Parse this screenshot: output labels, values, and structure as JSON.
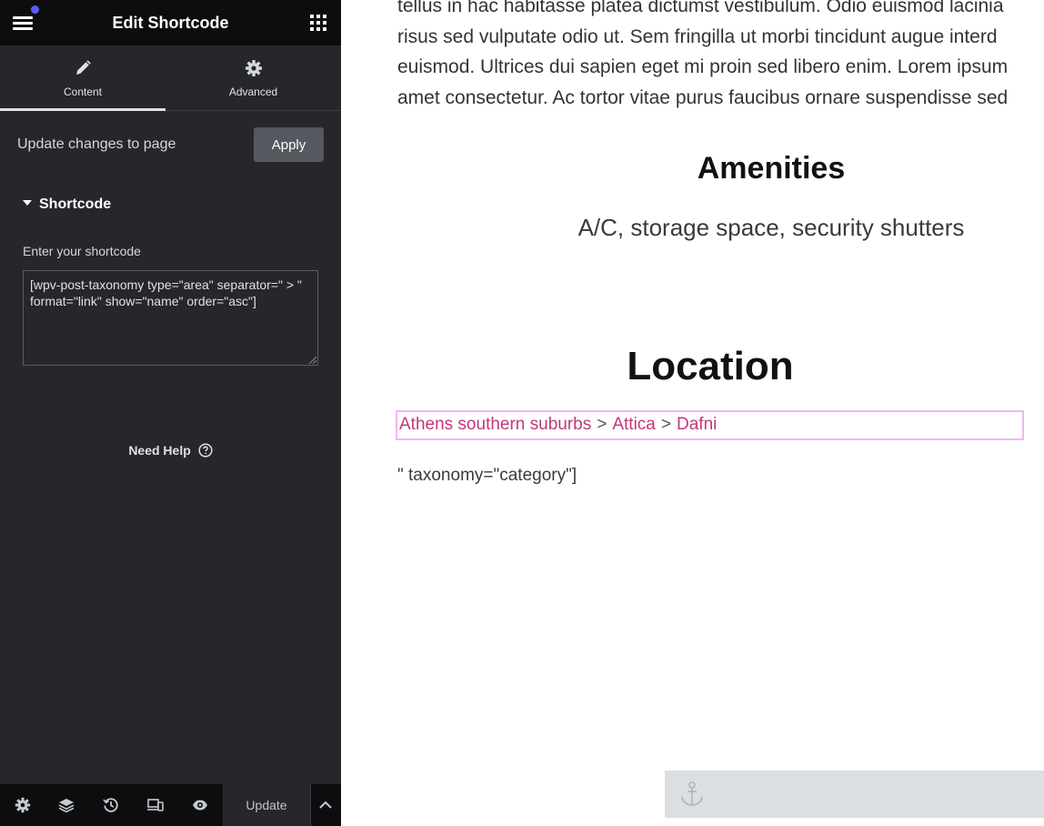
{
  "header": {
    "title": "Edit Shortcode"
  },
  "tabs": [
    {
      "label": "Content",
      "icon": "pencil-icon",
      "active": true
    },
    {
      "label": "Advanced",
      "icon": "gear-icon",
      "active": false
    }
  ],
  "apply_row": {
    "label": "Update changes to page",
    "button": "Apply"
  },
  "section": {
    "title": "Shortcode",
    "field_label": "Enter your shortcode",
    "field_value": "[wpv-post-taxonomy type=\"area\" separator=\" > \" format=\"link\" show=\"name\" order=\"asc\"]\n"
  },
  "help": {
    "label": "Need Help"
  },
  "footer": {
    "icons": [
      "settings-icon",
      "layers-icon",
      "history-icon",
      "responsive-icon",
      "eye-icon"
    ],
    "update_label": "Update"
  },
  "preview": {
    "paragraph_lines": [
      "tellus in hac habitasse platea dictumst vestibulum. Odio euismod lacinia",
      "risus sed vulputate odio ut. Sem fringilla ut morbi tincidunt augue interd",
      "euismod. Ultrices dui sapien eget mi proin sed libero enim. Lorem ipsum",
      "amet consectetur. Ac tortor vitae purus faucibus ornare suspendisse sed"
    ],
    "amenities_title": "Amenities",
    "amenities_text": "A/C, storage space, security shutters",
    "location_title": "Location",
    "location_links": [
      "Athens southern suburbs",
      "Attica",
      "Dafni"
    ],
    "location_separator": ">",
    "taxonomy_text": "\" taxonomy=\"category\"]"
  },
  "colors": {
    "sidebar_bg": "#26272b",
    "topbar_bg": "#0c0d0e",
    "notification_dot": "#5a5cf9",
    "link": "#c0377d",
    "selection_border": "#f2b7f2"
  }
}
